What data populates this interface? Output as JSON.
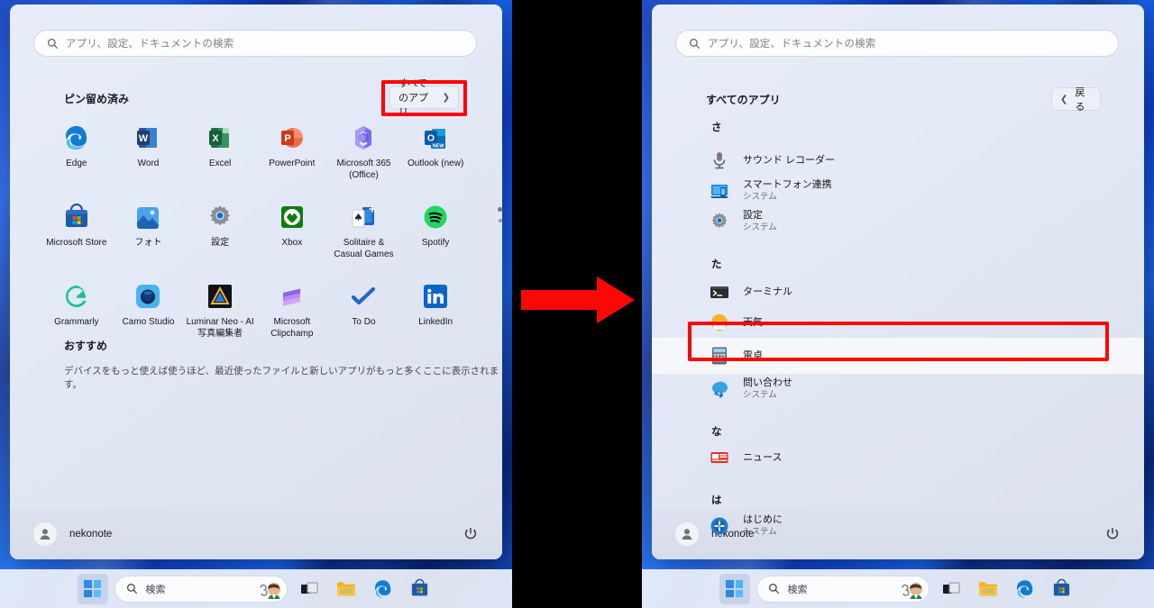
{
  "panels": {
    "left": {
      "search": {
        "placeholder": "アプリ、設定、ドキュメントの検索",
        "icon": "search-icon"
      },
      "pinned_header": "ピン留め済み",
      "all_apps_button": {
        "label": "すべてのアプリ",
        "chevron": "chevron-right-icon"
      },
      "pinned_apps": [
        {
          "name": "Edge",
          "icon": "edge-icon"
        },
        {
          "name": "Word",
          "icon": "word-icon"
        },
        {
          "name": "Excel",
          "icon": "excel-icon"
        },
        {
          "name": "PowerPoint",
          "icon": "powerpoint-icon"
        },
        {
          "name": "Microsoft 365 (Office)",
          "icon": "microsoft365-icon"
        },
        {
          "name": "Outlook (new)",
          "icon": "outlook-new-icon"
        },
        {
          "name": "Microsoft Store",
          "icon": "microsoft-store-icon"
        },
        {
          "name": "フォト",
          "icon": "photos-icon"
        },
        {
          "name": "設定",
          "icon": "settings-gear-icon"
        },
        {
          "name": "Xbox",
          "icon": "xbox-icon"
        },
        {
          "name": "Solitaire & Casual Games",
          "icon": "solitaire-icon"
        },
        {
          "name": "Spotify",
          "icon": "spotify-icon"
        },
        {
          "name": "Grammarly",
          "icon": "grammarly-icon"
        },
        {
          "name": "Camo Studio",
          "icon": "camo-studio-icon"
        },
        {
          "name": "Luminar Neo - AI 写真編集者",
          "icon": "luminar-neo-icon"
        },
        {
          "name": "Microsoft Clipchamp",
          "icon": "clipchamp-icon"
        },
        {
          "name": "To Do",
          "icon": "todo-icon"
        },
        {
          "name": "LinkedIn",
          "icon": "linkedin-icon"
        }
      ],
      "recommended_header": "おすすめ",
      "recommended_empty_text": "デバイスをもっと使えば使うほど、最近使ったファイルと新しいアプリがもっと多くここに表示されます。",
      "account": {
        "name": "nekonote",
        "avatar": "user-avatar-icon",
        "power": "power-icon"
      }
    },
    "right": {
      "search": {
        "placeholder": "アプリ、設定、ドキュメントの検索",
        "icon": "search-icon"
      },
      "all_apps_header": "すべてのアプリ",
      "back_button": {
        "label": "戻る",
        "chevron": "chevron-left-icon"
      },
      "groups": [
        {
          "letter": "さ",
          "items": [
            {
              "name": "サウンド レコーダー",
              "sub": "",
              "icon": "sound-recorder-icon"
            },
            {
              "name": "スマートフォン連携",
              "sub": "システム",
              "icon": "phone-link-icon"
            },
            {
              "name": "設定",
              "sub": "システム",
              "icon": "settings-gear-icon"
            }
          ]
        },
        {
          "letter": "た",
          "items": [
            {
              "name": "ターミナル",
              "sub": "",
              "icon": "terminal-icon"
            },
            {
              "name": "天気",
              "sub": "",
              "icon": "weather-icon"
            },
            {
              "name": "電卓",
              "sub": "",
              "icon": "calculator-icon",
              "highlighted": true
            },
            {
              "name": "問い合わせ",
              "sub": "システム",
              "icon": "get-help-icon"
            }
          ]
        },
        {
          "letter": "な",
          "items": [
            {
              "name": "ニュース",
              "sub": "",
              "icon": "news-icon"
            }
          ]
        },
        {
          "letter": "は",
          "items": [
            {
              "name": "はじめに",
              "sub": "システム",
              "icon": "get-started-icon"
            }
          ]
        }
      ],
      "account": {
        "name": "nekonote",
        "avatar": "user-avatar-icon",
        "power": "power-icon"
      }
    }
  },
  "taskbar": {
    "start": "windows-start-icon",
    "search_label": "検索",
    "search_icon": "search-icon",
    "copilot_icon": "copilot-avatar-icon",
    "items": [
      {
        "icon": "task-view-icon",
        "label": "タスク ビュー"
      },
      {
        "icon": "file-explorer-icon",
        "label": "エクスプローラー"
      },
      {
        "icon": "edge-icon",
        "label": "Microsoft Edge"
      },
      {
        "icon": "microsoft-store-icon",
        "label": "Microsoft Store"
      }
    ]
  },
  "annotation": {
    "arrow": "red-right-arrow",
    "highlight_color": "#fc0606",
    "left_highlight_target": "すべてのアプリ",
    "right_highlight_target": "電卓"
  }
}
